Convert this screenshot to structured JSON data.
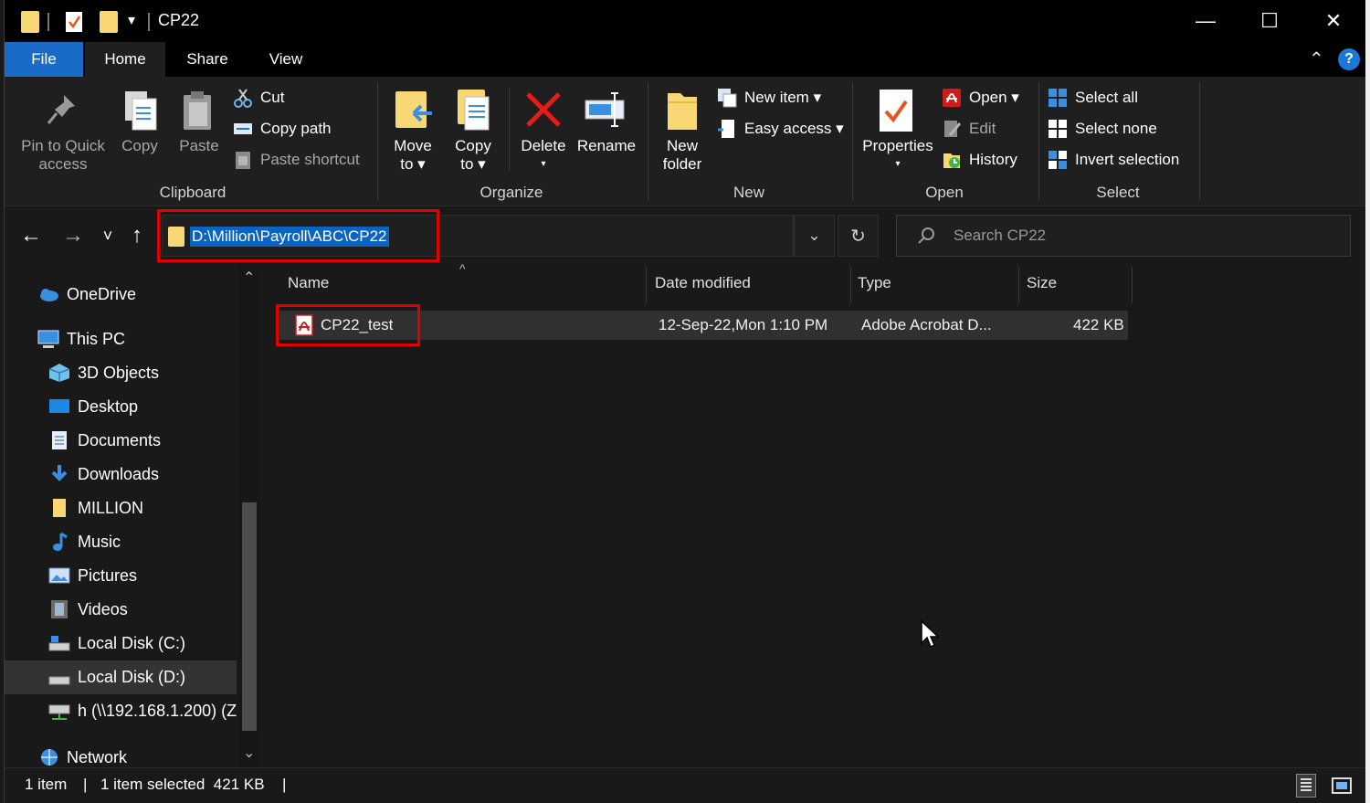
{
  "window": {
    "title": "CP22",
    "minimize_glyph": "—",
    "maximize_glyph": "☐",
    "close_glyph": "✕",
    "qat_dropdown_glyph": "▾"
  },
  "tabs": {
    "file": "File",
    "home": "Home",
    "share": "Share",
    "view": "View"
  },
  "ribbon_toggles": {
    "collapse_glyph": "⌃",
    "help_glyph": "?"
  },
  "ribbon": {
    "clipboard": {
      "label": "Clipboard",
      "pin_line1": "Pin to Quick",
      "pin_line2": "access",
      "copy": "Copy",
      "paste": "Paste",
      "cut": "Cut",
      "copy_path": "Copy path",
      "paste_shortcut": "Paste shortcut"
    },
    "organize": {
      "label": "Organize",
      "move_line1": "Move",
      "move_line2": "to ▾",
      "copy_line1": "Copy",
      "copy_line2": "to ▾",
      "delete": "Delete",
      "delete_arrow": "▾",
      "rename": "Rename"
    },
    "new": {
      "label": "New",
      "new_folder_line1": "New",
      "new_folder_line2": "folder",
      "new_item": "New item ▾",
      "easy_access": "Easy access ▾"
    },
    "open": {
      "label": "Open",
      "properties": "Properties",
      "properties_arrow": "▾",
      "open": "Open ▾",
      "edit": "Edit",
      "history": "History"
    },
    "select": {
      "label": "Select",
      "select_all": "Select all",
      "select_none": "Select none",
      "invert_selection": "Invert selection"
    }
  },
  "nav": {
    "back": "←",
    "forward": "→",
    "recent": "˅",
    "up": "↑",
    "address": "D:\\Million\\Payroll\\ABC\\CP22",
    "dropdown": "⌄",
    "refresh": "↻",
    "search_placeholder": "Search CP22"
  },
  "sidebar": {
    "scroll_up": "⌃",
    "scroll_down": "⌄",
    "items": [
      {
        "label": "OneDrive",
        "icon": "onedrive-icon"
      },
      {
        "label": "This PC",
        "icon": "this-pc-icon"
      },
      {
        "label": "3D Objects",
        "icon": "3d-objects-icon"
      },
      {
        "label": "Desktop",
        "icon": "desktop-icon"
      },
      {
        "label": "Documents",
        "icon": "documents-icon"
      },
      {
        "label": "Downloads",
        "icon": "downloads-icon"
      },
      {
        "label": "MILLION",
        "icon": "folder-icon"
      },
      {
        "label": "Music",
        "icon": "music-icon"
      },
      {
        "label": "Pictures",
        "icon": "pictures-icon"
      },
      {
        "label": "Videos",
        "icon": "videos-icon"
      },
      {
        "label": "Local Disk (C:)",
        "icon": "drive-icon"
      },
      {
        "label": "Local Disk (D:)",
        "icon": "drive-icon"
      },
      {
        "label": "h (\\\\192.168.1.200) (Z",
        "icon": "network-drive-icon"
      },
      {
        "label": "Network",
        "icon": "network-icon"
      }
    ]
  },
  "columns": {
    "sort_glyph": "^",
    "name": "Name",
    "date_modified": "Date modified",
    "type": "Type",
    "size": "Size"
  },
  "files": [
    {
      "name": "CP22_test",
      "date_modified": "12-Sep-22,Mon 1:10 PM",
      "type": "Adobe Acrobat D...",
      "size": "422 KB",
      "icon": "pdf-icon"
    }
  ],
  "status": {
    "count": "1 item",
    "sep": "|",
    "selection": "1 item selected  421 KB",
    "sep2": "|"
  },
  "colors": {
    "accent": "#1a6bc6",
    "highlight": "#e00000",
    "selection_bg": "#0b63c2"
  }
}
